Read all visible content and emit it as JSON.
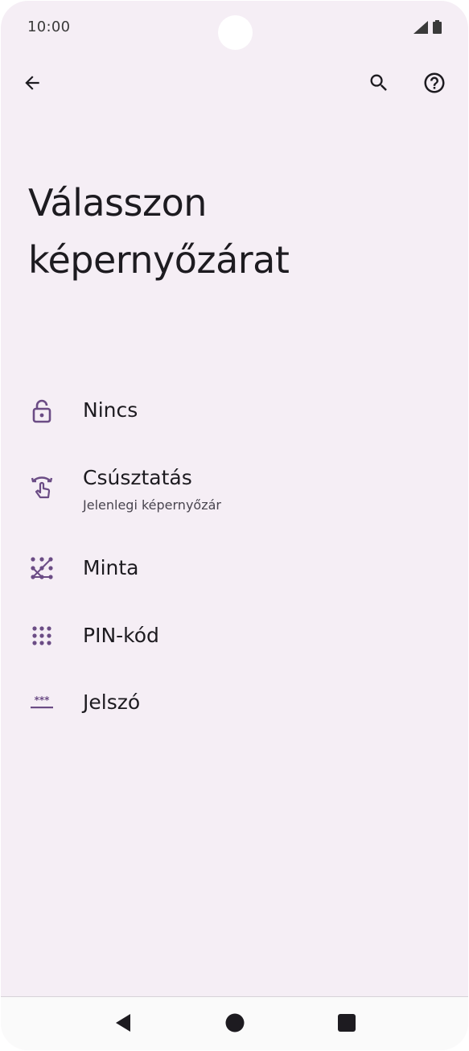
{
  "status_bar": {
    "time": "10:00",
    "signal_icon": "cellular-signal-icon",
    "battery_icon": "battery-icon"
  },
  "top_bar": {
    "back_icon": "arrow-back-icon",
    "search_icon": "search-icon",
    "help_icon": "help-icon"
  },
  "title_line1": "Válasszon",
  "title_line2": "képernyőzárat",
  "options": [
    {
      "label": "Nincs",
      "icon": "lock-open-icon"
    },
    {
      "label": "Csúsztatás",
      "sublabel": "Jelenlegi képernyőzár",
      "icon": "swipe-icon"
    },
    {
      "label": "Minta",
      "icon": "pattern-icon"
    },
    {
      "label": "PIN-kód",
      "icon": "pin-dialpad-icon"
    },
    {
      "label": "Jelszó",
      "icon": "password-icon"
    }
  ],
  "nav_bar": {
    "back": "nav-back-icon",
    "home": "nav-home-icon",
    "recents": "nav-recents-icon"
  },
  "colors": {
    "background": "#f5eef5",
    "accent": "#6b4c85",
    "text": "#1d1b20"
  }
}
